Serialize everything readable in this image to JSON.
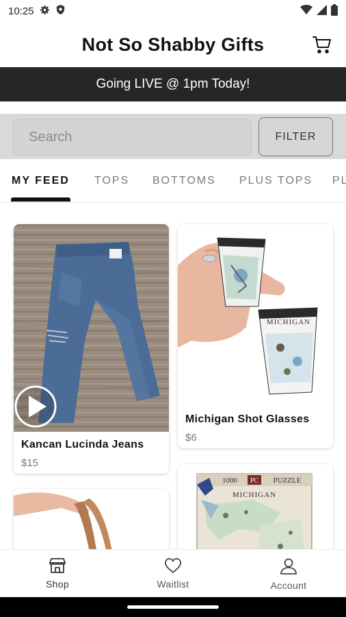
{
  "status": {
    "time": "10:25",
    "icons": [
      "gear-icon",
      "shield-icon",
      "wifi-icon",
      "cell-signal-icon",
      "battery-icon"
    ]
  },
  "header": {
    "title": "Not So Shabby Gifts",
    "cart_icon": "cart-icon"
  },
  "banner": {
    "text": "Going LIVE @ 1pm Today!"
  },
  "search": {
    "placeholder": "Search",
    "filter_label": "FILTER"
  },
  "tabs": [
    {
      "label": "MY FEED",
      "active": true
    },
    {
      "label": "TOPS",
      "active": false
    },
    {
      "label": "BOTTOMS",
      "active": false
    },
    {
      "label": "PLUS TOPS",
      "active": false
    },
    {
      "label": "PL",
      "active": false
    }
  ],
  "feed": {
    "items": [
      {
        "title": "Kancan Lucinda Jeans",
        "price": "$15",
        "has_video": true
      },
      {
        "title": "Michigan Shot Glasses",
        "price": "$6",
        "has_video": false
      },
      {
        "title": "",
        "price": "",
        "has_video": false
      },
      {
        "title": "",
        "price": "",
        "has_video": false
      }
    ],
    "image_text": {
      "puzzle_count": "1000",
      "puzzle_brand": "PC",
      "puzzle_word": "PUZZLE",
      "puzzle_map": "MICHIGAN",
      "glass_word": "MICHIGAN"
    }
  },
  "bottom_nav": [
    {
      "label": "Shop",
      "icon": "shop-icon",
      "active": true
    },
    {
      "label": "Waitlist",
      "icon": "heart-icon",
      "active": false
    },
    {
      "label": "Account",
      "icon": "person-icon",
      "active": false
    }
  ],
  "colors": {
    "banner_bg": "#262626",
    "search_bg": "#d9d9d9",
    "accent": "#111111"
  }
}
